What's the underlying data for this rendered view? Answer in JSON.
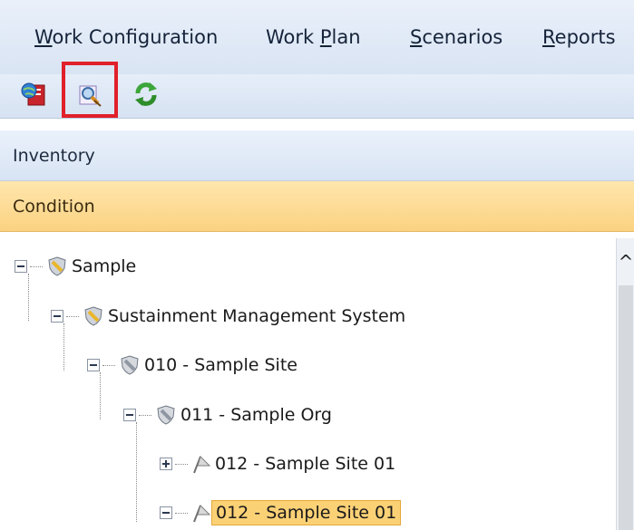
{
  "menubar": {
    "items": [
      {
        "pre": "",
        "key": "W",
        "post": "ork Configuration"
      },
      {
        "pre": "Work ",
        "key": "P",
        "post": "lan"
      },
      {
        "pre": "",
        "key": "S",
        "post": "cenarios"
      },
      {
        "pre": "",
        "key": "R",
        "post": "eports"
      }
    ]
  },
  "toolbar": {
    "buttons": [
      {
        "icon": "globe-document-icon"
      },
      {
        "icon": "inspection-edit-icon",
        "highlighted": true
      },
      {
        "icon": "refresh-icon"
      }
    ],
    "highlight_color": "#e0202a"
  },
  "panels": {
    "inventory_label": "Inventory",
    "condition_label": "Condition"
  },
  "tree": {
    "nodes": [
      {
        "label": "Sample",
        "icon": "shield-gold-icon",
        "expander": "minus"
      },
      {
        "label": "Sustainment Management System",
        "icon": "shield-gold-icon",
        "expander": "minus"
      },
      {
        "label": "010 - Sample Site",
        "icon": "shield-gray-icon",
        "expander": "minus"
      },
      {
        "label": "011 - Sample Org",
        "icon": "shield-gray-icon",
        "expander": "minus"
      },
      {
        "label": "012 - Sample Site 01",
        "icon": "flag-icon",
        "expander": "plus"
      },
      {
        "label": "012 - Sample Site 01",
        "icon": "flag-icon",
        "expander": "minus",
        "selected": true
      }
    ]
  },
  "colors": {
    "condition_header": "#fbd281",
    "selection": "#fbd176"
  }
}
